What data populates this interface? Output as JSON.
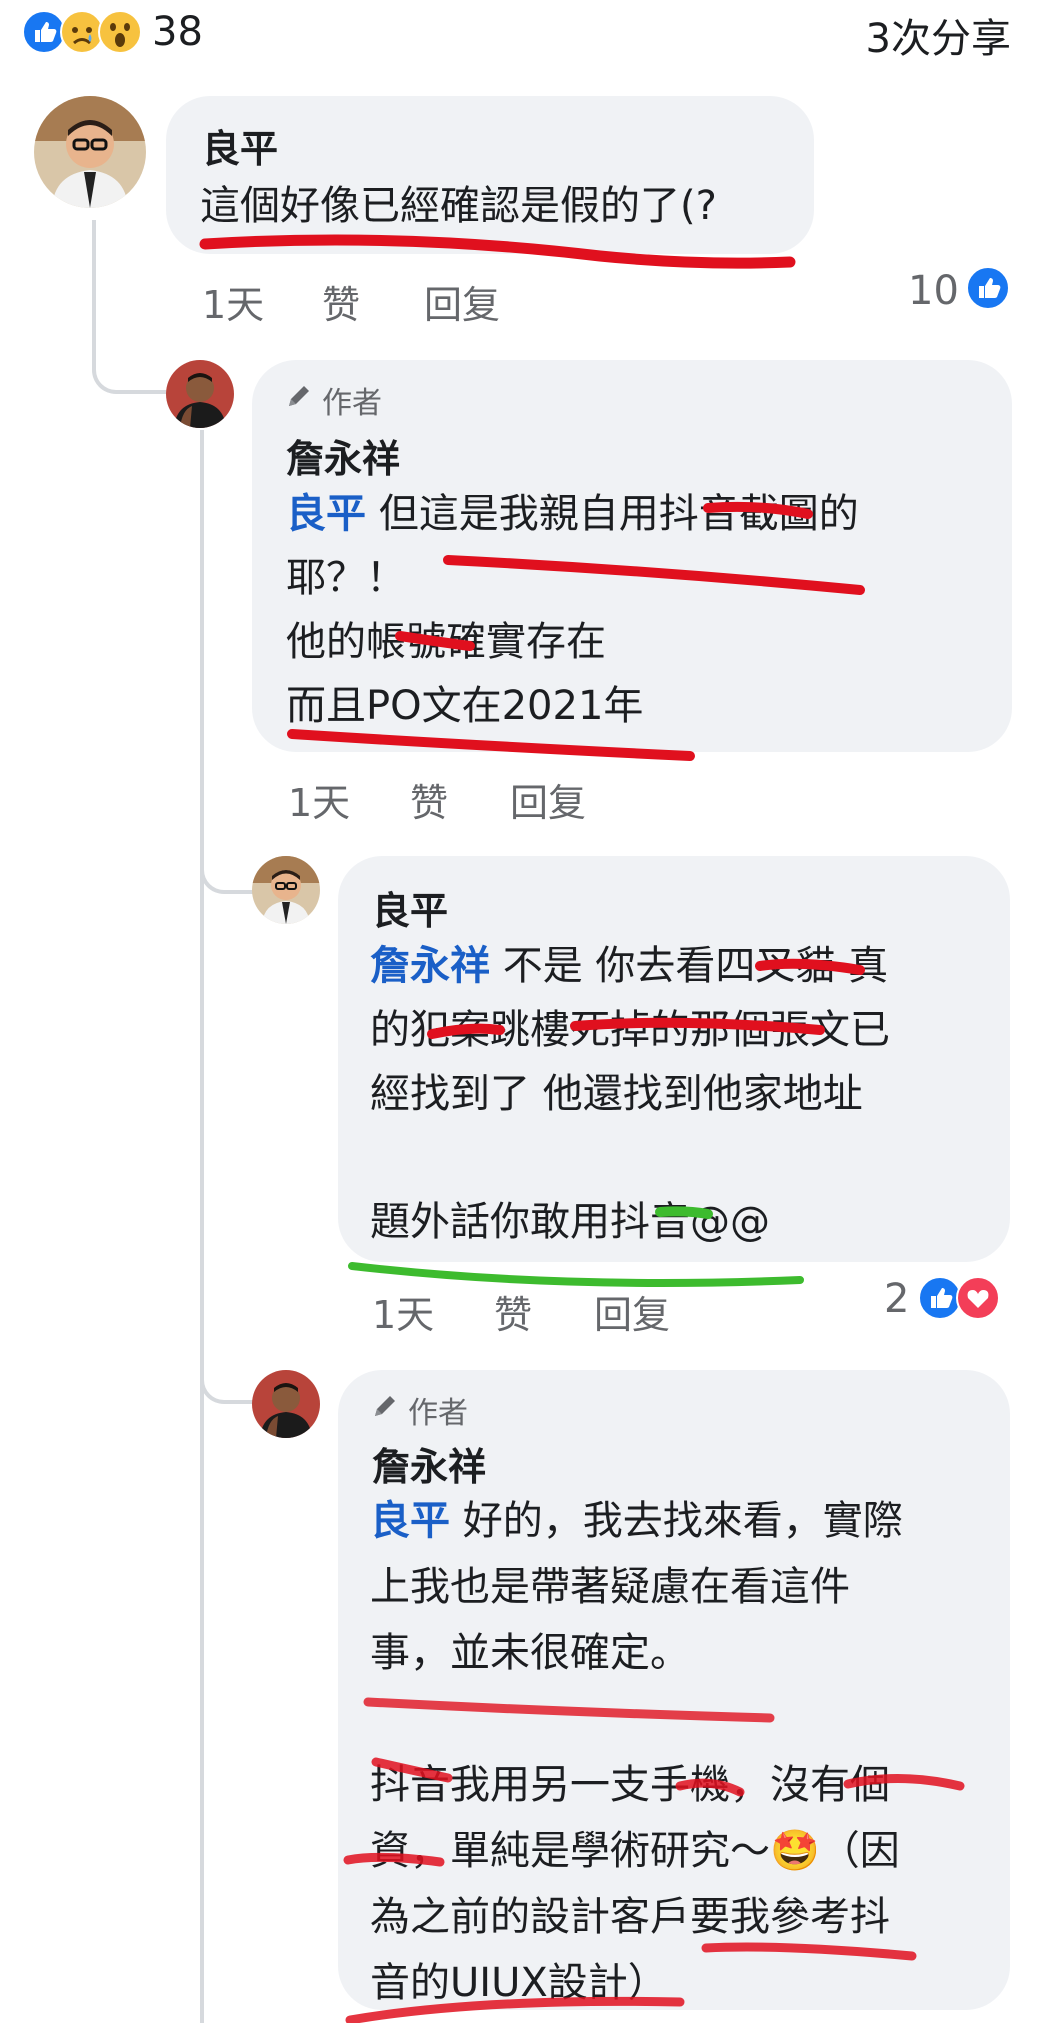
{
  "post_stats": {
    "reaction_icons": [
      "like-icon",
      "sad-icon",
      "wow-icon"
    ],
    "reaction_count": "38",
    "shares": "3次分享"
  },
  "comments": [
    {
      "author": "良平",
      "lines": [
        "這個好像已經確認是假的了(?"
      ],
      "time": "1天",
      "like_label": "赞",
      "reply_label": "回复",
      "reactions": "10"
    },
    {
      "badge": "作者",
      "author": "詹永祥",
      "mention": "良平",
      "lines": [
        " 但這是我親自用抖音截圖的",
        "耶？！",
        "他的帳號確實存在",
        "而且PO文在2021年"
      ],
      "time": "1天",
      "like_label": "赞",
      "reply_label": "回复"
    },
    {
      "author": "良平",
      "mention": "詹永祥",
      "lines": [
        " 不是 你去看四叉貓 真",
        "的犯案跳樓死掉的那個張文已",
        "經找到了 他還找到他家地址",
        "",
        "題外話你敢用抖音@@"
      ],
      "time": "1天",
      "like_label": "赞",
      "reply_label": "回复",
      "reactions": "2"
    },
    {
      "badge": "作者",
      "author": "詹永祥",
      "mention": "良平",
      "lines": [
        " 好的，我去找來看，實際",
        "上我也是帶著疑慮在看這件",
        "事，並未很確定。",
        "",
        "抖音我用另一支手機，沒有個",
        "資，單純是學術研究～🤩（因",
        "為之前的設計客戶要我參考抖",
        "音的UIUX設計）"
      ]
    }
  ],
  "colors": {
    "bubble": "#f0f2f5",
    "mention": "#1a5fc7",
    "like_blue": "#1877f2",
    "love_red": "#f33e58",
    "marker_red": "#e0101e",
    "marker_green": "#3dbb2e"
  }
}
